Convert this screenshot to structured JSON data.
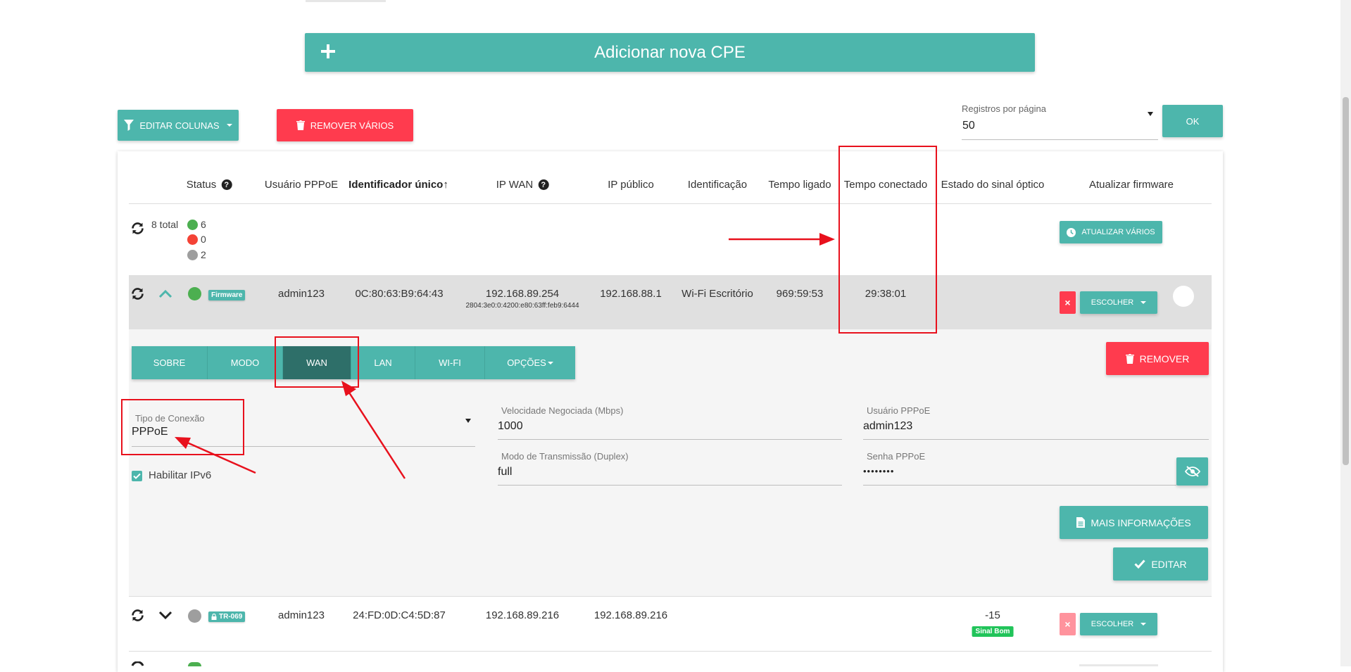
{
  "add_cpe": {
    "label": "Adicionar nova CPE"
  },
  "toolbar": {
    "edit_columns": "EDITAR COLUNAS",
    "remove_many": "REMOVER VÁRIOS",
    "records_label": "Registros por página",
    "records_value": "50",
    "ok": "OK"
  },
  "table": {
    "headers": {
      "status": "Status",
      "pppoe_user": "Usuário PPPoE",
      "unique_id": "Identificador único↑",
      "ip_wan": "IP WAN",
      "ip_public": "IP público",
      "identification": "Identificação",
      "uptime": "Tempo ligado",
      "connected_time": "Tempo conectado",
      "optical_signal": "Estado do sinal óptico",
      "update_firmware": "Atualizar firmware"
    },
    "summary": {
      "total": "8 total",
      "online": "6",
      "offline": "0",
      "unknown": "2",
      "update_many": "ATUALIZAR VÁRIOS"
    },
    "rows": [
      {
        "badge": "Firmware",
        "pppoe_user": "admin123",
        "unique_id": "0C:80:63:B9:64:43",
        "ip_wan": "192.168.89.254",
        "ip_wan_v6": "2804:3e0:0:4200:e80:63ff:feb9:6444",
        "ip_public": "192.168.88.1",
        "identification": "Wi-Fi Escritório",
        "uptime": "969:59:53",
        "connected_time": "29:38:01",
        "choose": "ESCOLHER"
      },
      {
        "badge": "TR-069",
        "pppoe_user": "admin123",
        "unique_id": "24:FD:0D:C4:5D:87",
        "ip_wan": "192.168.89.216",
        "ip_public": "192.168.89.216",
        "signal_value": "-15",
        "signal_label": "Sinal Bom",
        "choose": "ESCOLHER"
      }
    ]
  },
  "detail": {
    "tabs": [
      "SOBRE",
      "MODO",
      "WAN",
      "LAN",
      "WI-FI",
      "OPÇÕES"
    ],
    "active_tab": "WAN",
    "remove": "REMOVER",
    "connection_type_label": "Tipo de Conexão",
    "connection_type_value": "PPPoE",
    "ipv6_label": "Habilitar IPv6",
    "speed_label": "Velocidade Negociada (Mbps)",
    "speed_value": "1000",
    "duplex_label": "Modo de Transmissão (Duplex)",
    "duplex_value": "full",
    "pppoe_user_label": "Usuário PPPoE",
    "pppoe_user_value": "admin123",
    "pppoe_pass_label": "Senha PPPoE",
    "pppoe_pass_value": "••••••••",
    "more_info": "MAIS INFORMAÇÕES",
    "edit": "EDITAR"
  },
  "colors": {
    "teal": "#4db6ac",
    "teal_dark": "#2e6f69",
    "red": "#ff3b4e",
    "annotation_red": "#e8111d",
    "online": "#4caf50",
    "offline": "#f44336",
    "unknown": "#9e9e9e"
  },
  "icons": [
    "plus-icon",
    "filter-icon",
    "trash-icon",
    "help-icon",
    "refresh-icon",
    "chevron-up-icon",
    "chevron-down-icon",
    "clock-icon",
    "lock-icon",
    "eye-off-icon",
    "document-icon",
    "check-icon",
    "dropdown-arrow-icon"
  ]
}
